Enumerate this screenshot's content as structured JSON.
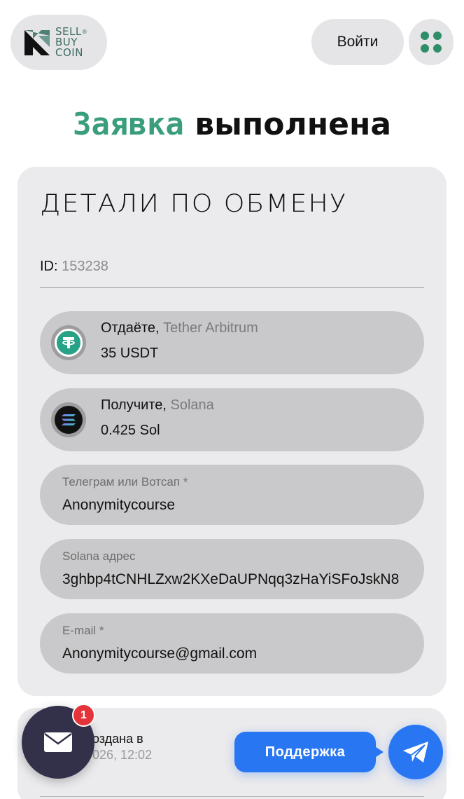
{
  "header": {
    "logo": {
      "line1": "SELL",
      "line2": "BUY",
      "line3": "COIN",
      "reg": "®"
    },
    "login_label": "Войти",
    "menu_icon": "grid-dots-icon"
  },
  "title": {
    "accent": "Заявка",
    "rest": " выполнена"
  },
  "details": {
    "heading": "ДЕТАЛИ ПО ОБМЕНУ",
    "id_label": "ID:",
    "id_value": "153238",
    "give": {
      "label": "Отдаёте,",
      "network": "Tether Arbitrum",
      "amount": "35 USDT"
    },
    "receive": {
      "label": "Получите,",
      "network": "Solana",
      "amount": "0.425 Sol"
    },
    "contact": {
      "label": "Телеграм или Вотсап *",
      "value": "Anonymitycourse"
    },
    "address": {
      "label": "Solana адрес",
      "value": "3ghbp4tCNHLZxw2KXeDaUPNqq3zHaYiSFoJskN8"
    },
    "email": {
      "label": "E-mail *",
      "value": "Anonymitycourse@gmail.com"
    }
  },
  "meta": {
    "created_label": "оздана в",
    "created_time": "026, 12:02"
  },
  "widgets": {
    "badge_count": "1",
    "support_label": "Поддержка"
  },
  "colors": {
    "accent_green": "#3a9e7c",
    "support_blue": "#2876f2",
    "badge_red": "#e5333a",
    "mail_dark": "#33304a"
  }
}
